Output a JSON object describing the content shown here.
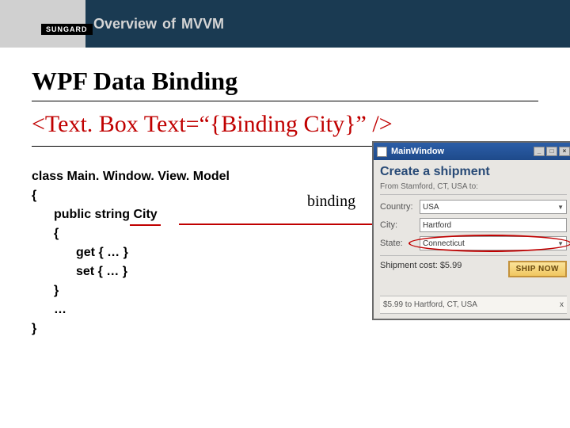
{
  "header": {
    "brand": "SUNGARD",
    "title": "Overview of MVVM"
  },
  "slide": {
    "heading": "WPF Data Binding",
    "xaml": "<Text. Box Text=“{Binding City}” />",
    "binding_label": "binding"
  },
  "code": {
    "line1a": "class ",
    "line1b": "Main. Window. View. Model",
    "line2": "{",
    "line3a": "public string ",
    "line3b": "City",
    "line4": "{",
    "line5": "get { … }",
    "line6": "set { … }",
    "line7": "}",
    "line8": "…",
    "line9": "}"
  },
  "form": {
    "title": "MainWindow",
    "heading": "Create a shipment",
    "sub": "From Stamford, CT, USA to:",
    "country_label": "Country:",
    "country_value": "USA",
    "city_label": "City:",
    "city_value": "Hartford",
    "state_label": "State:",
    "state_value": "Connecticut",
    "cost_label": "Shipment cost: $5.99",
    "ship_btn": "SHIP NOW",
    "result": "$5.99 to Hartford, CT, USA",
    "close_x": "x"
  }
}
